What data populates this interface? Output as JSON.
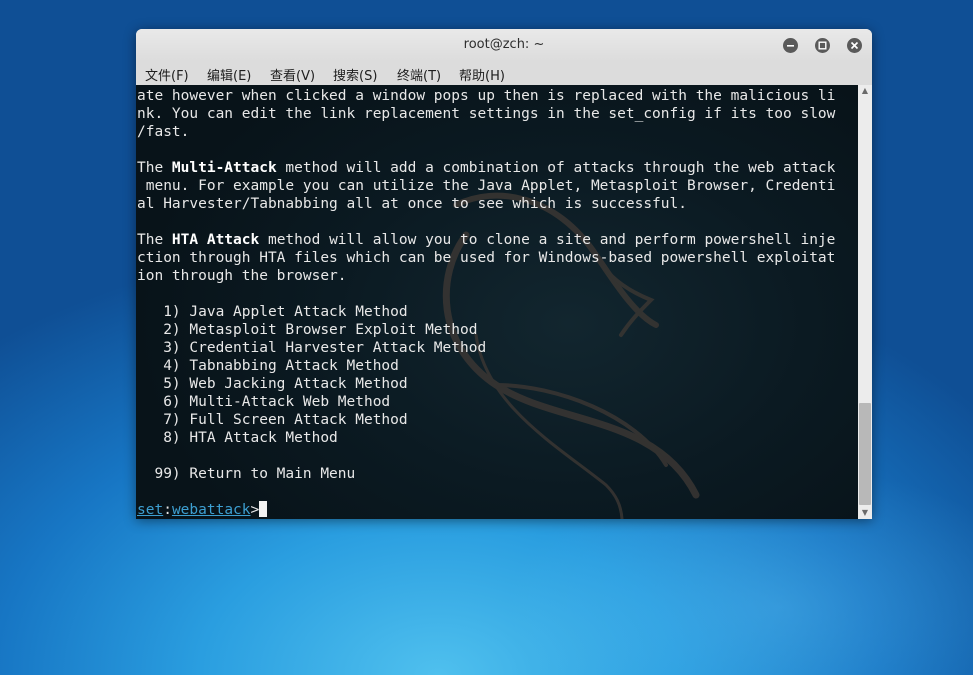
{
  "window": {
    "title": "root@zch: ~"
  },
  "menubar": {
    "items": [
      "文件(F)",
      "编辑(E)",
      "查看(V)",
      "搜索(S)",
      "终端(T)",
      "帮助(H)"
    ]
  },
  "terminal": {
    "lines": [
      "ate however when clicked a window pops up then is replaced with the malicious li",
      "nk. You can edit the link replacement settings in the set_config if its too slow",
      "/fast.",
      "",
      "The Multi-Attack method will add a combination of attacks through the web attack",
      " menu. For example you can utilize the Java Applet, Metasploit Browser, Credenti",
      "al Harvester/Tabnabbing all at once to see which is successful.",
      "",
      "The HTA Attack method will allow you to clone a site and perform powershell inje",
      "ction through HTA files which can be used for Windows-based powershell exploitat",
      "ion through the browser.",
      ""
    ],
    "multi_attack": {
      "pre": "The ",
      "bold": "Multi-Attack",
      "post": " method will add a combination of attacks through the web attack"
    },
    "hta_attack": {
      "pre": "The ",
      "bold": "HTA Attack",
      "post": " method will allow you to clone a site and perform powershell inje"
    },
    "menu_options": [
      "   1) Java Applet Attack Method",
      "   2) Metasploit Browser Exploit Method",
      "   3) Credential Harvester Attack Method",
      "   4) Tabnabbing Attack Method",
      "   5) Web Jacking Attack Method",
      "   6) Multi-Attack Web Method",
      "   7) Full Screen Attack Method",
      "   8) HTA Attack Method"
    ],
    "return_option": "  99) Return to Main Menu",
    "prompt": {
      "set": "set",
      "colon": ":",
      "module": "webattack",
      "gt": ">"
    }
  },
  "scrollbar": {
    "up_arrow": "▲",
    "down_arrow": "▼"
  },
  "colors": {
    "terminal_bg": "#0b1a22",
    "terminal_fg": "#e8e8e8",
    "prompt_blue": "#3d9fd1",
    "titlebar": "#dcdcdc"
  }
}
